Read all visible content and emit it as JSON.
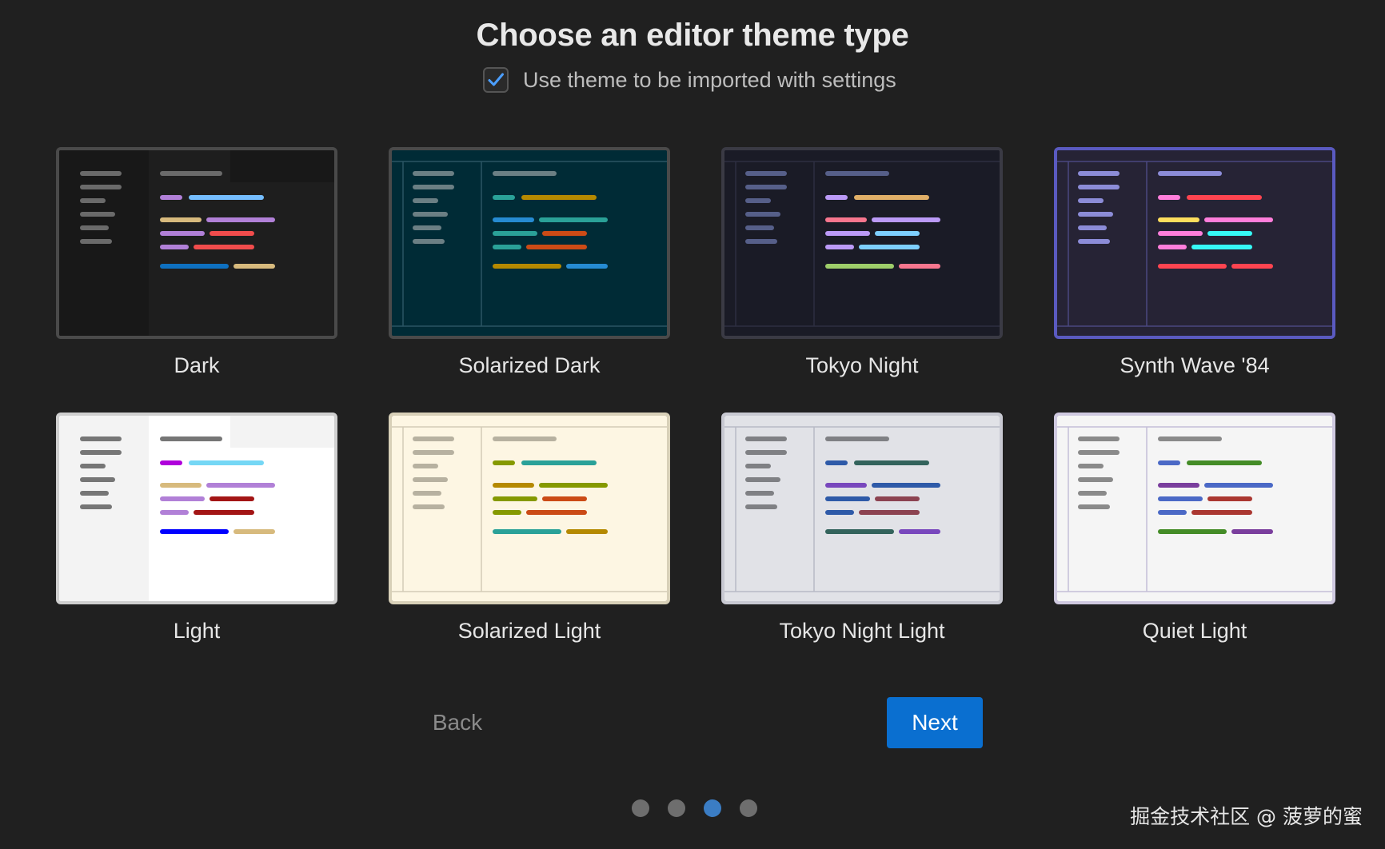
{
  "title": "Choose an editor theme type",
  "import_option": {
    "label": "Use theme to be imported with settings",
    "checked": true
  },
  "themes": [
    {
      "name": "Dark",
      "selected": true,
      "border": "#4a4a4a",
      "bg": "#1e1e1e",
      "sidebar": "#181818",
      "frame": false,
      "frameLine": "#333333",
      "muted": "#6a6a6a",
      "rows": [
        [
          "#b180d7",
          "#75beff"
        ],
        [
          "#d7ba7d",
          "#b180d7"
        ],
        [
          "#b180d7",
          "#f14c4c"
        ],
        [
          "#b180d7",
          "#f14c4c"
        ],
        [
          "#0e70c0",
          "#d7ba7d"
        ]
      ]
    },
    {
      "name": "Solarized Dark",
      "selected": false,
      "border": "#4a4a4a",
      "bg": "#002b36",
      "sidebar": "#002b36",
      "frame": true,
      "frameLine": "#2a5563",
      "muted": "#6b7f84",
      "rows": [
        [
          "#2aa198",
          "#b58900"
        ],
        [
          "#268bd2",
          "#2aa198"
        ],
        [
          "#2aa198",
          "#cb4b16"
        ],
        [
          "#2aa198",
          "#cb4b16"
        ],
        [
          "#b58900",
          "#268bd2"
        ]
      ]
    },
    {
      "name": "Tokyo Night",
      "selected": false,
      "border": "#3a3a44",
      "bg": "#1a1b26",
      "sidebar": "#1a1b26",
      "frame": true,
      "frameLine": "#2c2e40",
      "muted": "#565f89",
      "rows": [
        [
          "#bb9af7",
          "#e0af68"
        ],
        [
          "#f7768e",
          "#bb9af7"
        ],
        [
          "#bb9af7",
          "#7dcfff"
        ],
        [
          "#bb9af7",
          "#7dcfff"
        ],
        [
          "#9ece6a",
          "#f7768e"
        ]
      ]
    },
    {
      "name": "Synth Wave '84",
      "selected": false,
      "border": "#5a5ac0",
      "bg": "#262335",
      "sidebar": "#262335",
      "frame": true,
      "frameLine": "#4a4880",
      "muted": "#8c8cd8",
      "rows": [
        [
          "#ff7edb",
          "#fe4450"
        ],
        [
          "#fede5d",
          "#ff7edb"
        ],
        [
          "#ff7edb",
          "#36f9f6"
        ],
        [
          "#ff7edb",
          "#36f9f6"
        ],
        [
          "#fe4450",
          "#fe4450"
        ]
      ]
    },
    {
      "name": "Light",
      "selected": false,
      "border": "#cfcfcf",
      "bg": "#ffffff",
      "sidebar": "#f3f3f3",
      "frame": false,
      "frameLine": "#e0e0e0",
      "muted": "#767676",
      "rows": [
        [
          "#af00db",
          "#75d7f5"
        ],
        [
          "#d7ba7d",
          "#b180d7"
        ],
        [
          "#b180d7",
          "#a31515"
        ],
        [
          "#b180d7",
          "#a31515"
        ],
        [
          "#0000ff",
          "#d7ba7d"
        ]
      ]
    },
    {
      "name": "Solarized Light",
      "selected": false,
      "border": "#d8d0b8",
      "bg": "#fdf6e3",
      "sidebar": "#fdf6e3",
      "frame": true,
      "frameLine": "#d3cbb7",
      "muted": "#b7b1a0",
      "rows": [
        [
          "#859900",
          "#2aa198"
        ],
        [
          "#b58900",
          "#859900"
        ],
        [
          "#859900",
          "#cb4b16"
        ],
        [
          "#859900",
          "#cb4b16"
        ],
        [
          "#2aa198",
          "#b58900"
        ]
      ]
    },
    {
      "name": "Tokyo Night Light",
      "selected": false,
      "border": "#c8c9d2",
      "bg": "#e1e2e7",
      "sidebar": "#e1e2e7",
      "frame": true,
      "frameLine": "#b8bac6",
      "muted": "#7f8084",
      "rows": [
        [
          "#2e5aa8",
          "#33635c"
        ],
        [
          "#7847bd",
          "#2e5aa8"
        ],
        [
          "#2e5aa8",
          "#8c4351"
        ],
        [
          "#2e5aa8",
          "#8c4351"
        ],
        [
          "#33635c",
          "#7847bd"
        ]
      ]
    },
    {
      "name": "Quiet Light",
      "selected": false,
      "border": "#cfc9e0",
      "bg": "#f5f5f5",
      "sidebar": "#f5f5f5",
      "frame": true,
      "frameLine": "#c4bfd8",
      "muted": "#8a8a8a",
      "rows": [
        [
          "#4b69c6",
          "#448c27"
        ],
        [
          "#7a3e9d",
          "#4b69c6"
        ],
        [
          "#4b69c6",
          "#aa3731"
        ],
        [
          "#4b69c6",
          "#aa3731"
        ],
        [
          "#448c27",
          "#7a3e9d"
        ]
      ]
    }
  ],
  "buttons": {
    "back": "Back",
    "next": "Next"
  },
  "pager": {
    "count": 4,
    "active": 3
  },
  "watermark": "掘金技术社区 @ 菠萝的蜜",
  "colors": {
    "background": "#202020",
    "accent": "#0a6fd0",
    "dot": "#6e6e6e",
    "dot_active": "#3b7dc4"
  }
}
